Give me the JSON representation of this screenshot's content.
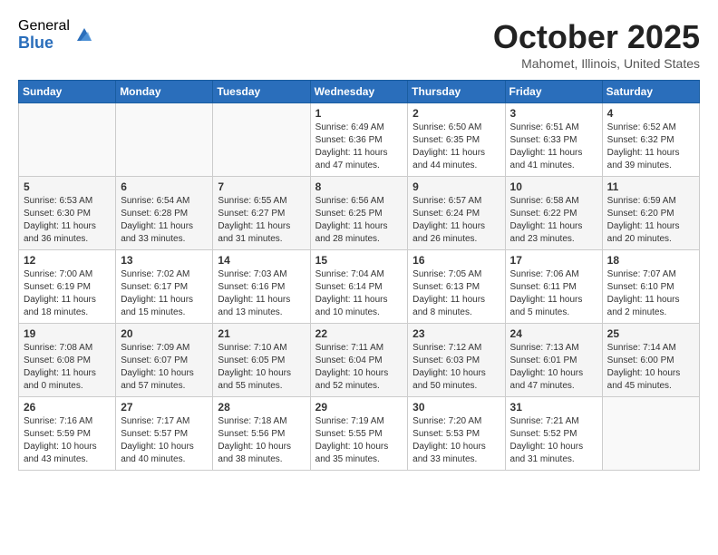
{
  "header": {
    "logo_general": "General",
    "logo_blue": "Blue",
    "title": "October 2025",
    "location": "Mahomet, Illinois, United States"
  },
  "weekdays": [
    "Sunday",
    "Monday",
    "Tuesday",
    "Wednesday",
    "Thursday",
    "Friday",
    "Saturday"
  ],
  "weeks": [
    [
      {
        "day": "",
        "info": ""
      },
      {
        "day": "",
        "info": ""
      },
      {
        "day": "",
        "info": ""
      },
      {
        "day": "1",
        "info": "Sunrise: 6:49 AM\nSunset: 6:36 PM\nDaylight: 11 hours\nand 47 minutes."
      },
      {
        "day": "2",
        "info": "Sunrise: 6:50 AM\nSunset: 6:35 PM\nDaylight: 11 hours\nand 44 minutes."
      },
      {
        "day": "3",
        "info": "Sunrise: 6:51 AM\nSunset: 6:33 PM\nDaylight: 11 hours\nand 41 minutes."
      },
      {
        "day": "4",
        "info": "Sunrise: 6:52 AM\nSunset: 6:32 PM\nDaylight: 11 hours\nand 39 minutes."
      }
    ],
    [
      {
        "day": "5",
        "info": "Sunrise: 6:53 AM\nSunset: 6:30 PM\nDaylight: 11 hours\nand 36 minutes."
      },
      {
        "day": "6",
        "info": "Sunrise: 6:54 AM\nSunset: 6:28 PM\nDaylight: 11 hours\nand 33 minutes."
      },
      {
        "day": "7",
        "info": "Sunrise: 6:55 AM\nSunset: 6:27 PM\nDaylight: 11 hours\nand 31 minutes."
      },
      {
        "day": "8",
        "info": "Sunrise: 6:56 AM\nSunset: 6:25 PM\nDaylight: 11 hours\nand 28 minutes."
      },
      {
        "day": "9",
        "info": "Sunrise: 6:57 AM\nSunset: 6:24 PM\nDaylight: 11 hours\nand 26 minutes."
      },
      {
        "day": "10",
        "info": "Sunrise: 6:58 AM\nSunset: 6:22 PM\nDaylight: 11 hours\nand 23 minutes."
      },
      {
        "day": "11",
        "info": "Sunrise: 6:59 AM\nSunset: 6:20 PM\nDaylight: 11 hours\nand 20 minutes."
      }
    ],
    [
      {
        "day": "12",
        "info": "Sunrise: 7:00 AM\nSunset: 6:19 PM\nDaylight: 11 hours\nand 18 minutes."
      },
      {
        "day": "13",
        "info": "Sunrise: 7:02 AM\nSunset: 6:17 PM\nDaylight: 11 hours\nand 15 minutes."
      },
      {
        "day": "14",
        "info": "Sunrise: 7:03 AM\nSunset: 6:16 PM\nDaylight: 11 hours\nand 13 minutes."
      },
      {
        "day": "15",
        "info": "Sunrise: 7:04 AM\nSunset: 6:14 PM\nDaylight: 11 hours\nand 10 minutes."
      },
      {
        "day": "16",
        "info": "Sunrise: 7:05 AM\nSunset: 6:13 PM\nDaylight: 11 hours\nand 8 minutes."
      },
      {
        "day": "17",
        "info": "Sunrise: 7:06 AM\nSunset: 6:11 PM\nDaylight: 11 hours\nand 5 minutes."
      },
      {
        "day": "18",
        "info": "Sunrise: 7:07 AM\nSunset: 6:10 PM\nDaylight: 11 hours\nand 2 minutes."
      }
    ],
    [
      {
        "day": "19",
        "info": "Sunrise: 7:08 AM\nSunset: 6:08 PM\nDaylight: 11 hours\nand 0 minutes."
      },
      {
        "day": "20",
        "info": "Sunrise: 7:09 AM\nSunset: 6:07 PM\nDaylight: 10 hours\nand 57 minutes."
      },
      {
        "day": "21",
        "info": "Sunrise: 7:10 AM\nSunset: 6:05 PM\nDaylight: 10 hours\nand 55 minutes."
      },
      {
        "day": "22",
        "info": "Sunrise: 7:11 AM\nSunset: 6:04 PM\nDaylight: 10 hours\nand 52 minutes."
      },
      {
        "day": "23",
        "info": "Sunrise: 7:12 AM\nSunset: 6:03 PM\nDaylight: 10 hours\nand 50 minutes."
      },
      {
        "day": "24",
        "info": "Sunrise: 7:13 AM\nSunset: 6:01 PM\nDaylight: 10 hours\nand 47 minutes."
      },
      {
        "day": "25",
        "info": "Sunrise: 7:14 AM\nSunset: 6:00 PM\nDaylight: 10 hours\nand 45 minutes."
      }
    ],
    [
      {
        "day": "26",
        "info": "Sunrise: 7:16 AM\nSunset: 5:59 PM\nDaylight: 10 hours\nand 43 minutes."
      },
      {
        "day": "27",
        "info": "Sunrise: 7:17 AM\nSunset: 5:57 PM\nDaylight: 10 hours\nand 40 minutes."
      },
      {
        "day": "28",
        "info": "Sunrise: 7:18 AM\nSunset: 5:56 PM\nDaylight: 10 hours\nand 38 minutes."
      },
      {
        "day": "29",
        "info": "Sunrise: 7:19 AM\nSunset: 5:55 PM\nDaylight: 10 hours\nand 35 minutes."
      },
      {
        "day": "30",
        "info": "Sunrise: 7:20 AM\nSunset: 5:53 PM\nDaylight: 10 hours\nand 33 minutes."
      },
      {
        "day": "31",
        "info": "Sunrise: 7:21 AM\nSunset: 5:52 PM\nDaylight: 10 hours\nand 31 minutes."
      },
      {
        "day": "",
        "info": ""
      }
    ]
  ]
}
